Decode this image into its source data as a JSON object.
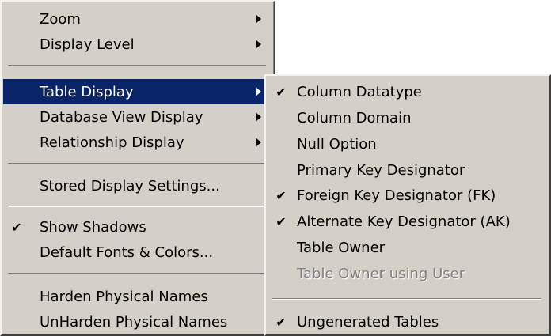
{
  "main_menu": {
    "zoom": "Zoom",
    "display_level": "Display Level",
    "table_display": "Table Display",
    "database_view_display": "Database View Display",
    "relationship_display": "Relationship Display",
    "stored_display_settings": "Stored Display Settings...",
    "show_shadows": "Show Shadows",
    "default_fonts_colors": "Default Fonts & Colors...",
    "harden_physical_names": "Harden Physical Names",
    "unharden_physical_names": "UnHarden Physical Names"
  },
  "submenu": {
    "column_datatype": "Column Datatype",
    "column_domain": "Column Domain",
    "null_option": "Null Option",
    "primary_key_designator": "Primary Key Designator",
    "foreign_key_designator": "Foreign Key Designator (FK)",
    "alternate_key_designator": "Alternate Key Designator (AK)",
    "table_owner": "Table Owner",
    "table_owner_using_user": "Table Owner using User",
    "ungenerated_tables": "Ungenerated Tables"
  },
  "check_glyph": "✔",
  "colors": {
    "menu_bg": "#d4d0c8",
    "highlight_bg": "#0a246a",
    "highlight_text": "#ffffff",
    "disabled_text": "#808080"
  }
}
